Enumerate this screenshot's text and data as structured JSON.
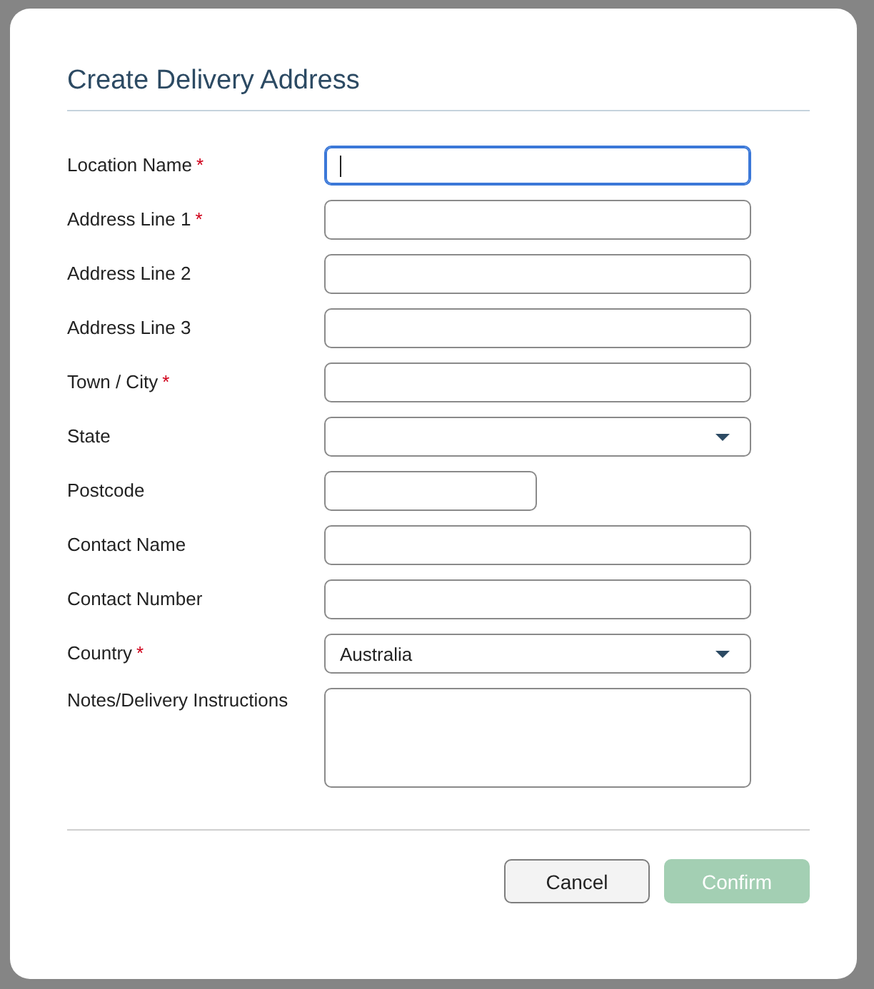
{
  "dialog": {
    "title": "Create Delivery Address",
    "fields": [
      {
        "label": "Location Name",
        "required_mark": "*",
        "kind": "text",
        "focused": true
      },
      {
        "label": "Address Line 1",
        "required_mark": "*",
        "kind": "text",
        "focused": false
      },
      {
        "label": "Address Line 2",
        "kind": "text",
        "focused": false
      },
      {
        "label": "Address Line 3",
        "kind": "text",
        "focused": false
      },
      {
        "label": "Town / City",
        "required_mark": "*",
        "kind": "text",
        "focused": false
      },
      {
        "label": "State",
        "kind": "select",
        "focused": false
      },
      {
        "label": "Postcode",
        "kind": "short",
        "focused": false
      },
      {
        "label": "Contact Name",
        "kind": "text",
        "focused": false
      },
      {
        "label": "Contact Number",
        "kind": "text",
        "focused": false
      },
      {
        "label": "Country",
        "required_mark": "*",
        "kind": "select",
        "value": "Australia",
        "focused": false
      },
      {
        "label": "Notes/Delivery Instructions",
        "kind": "textarea",
        "focused": false
      }
    ],
    "buttons": [
      {
        "label": "Cancel",
        "kind": "secondary",
        "disabled": false
      },
      {
        "label": "Confirm",
        "kind": "primary",
        "disabled": true
      }
    ]
  }
}
